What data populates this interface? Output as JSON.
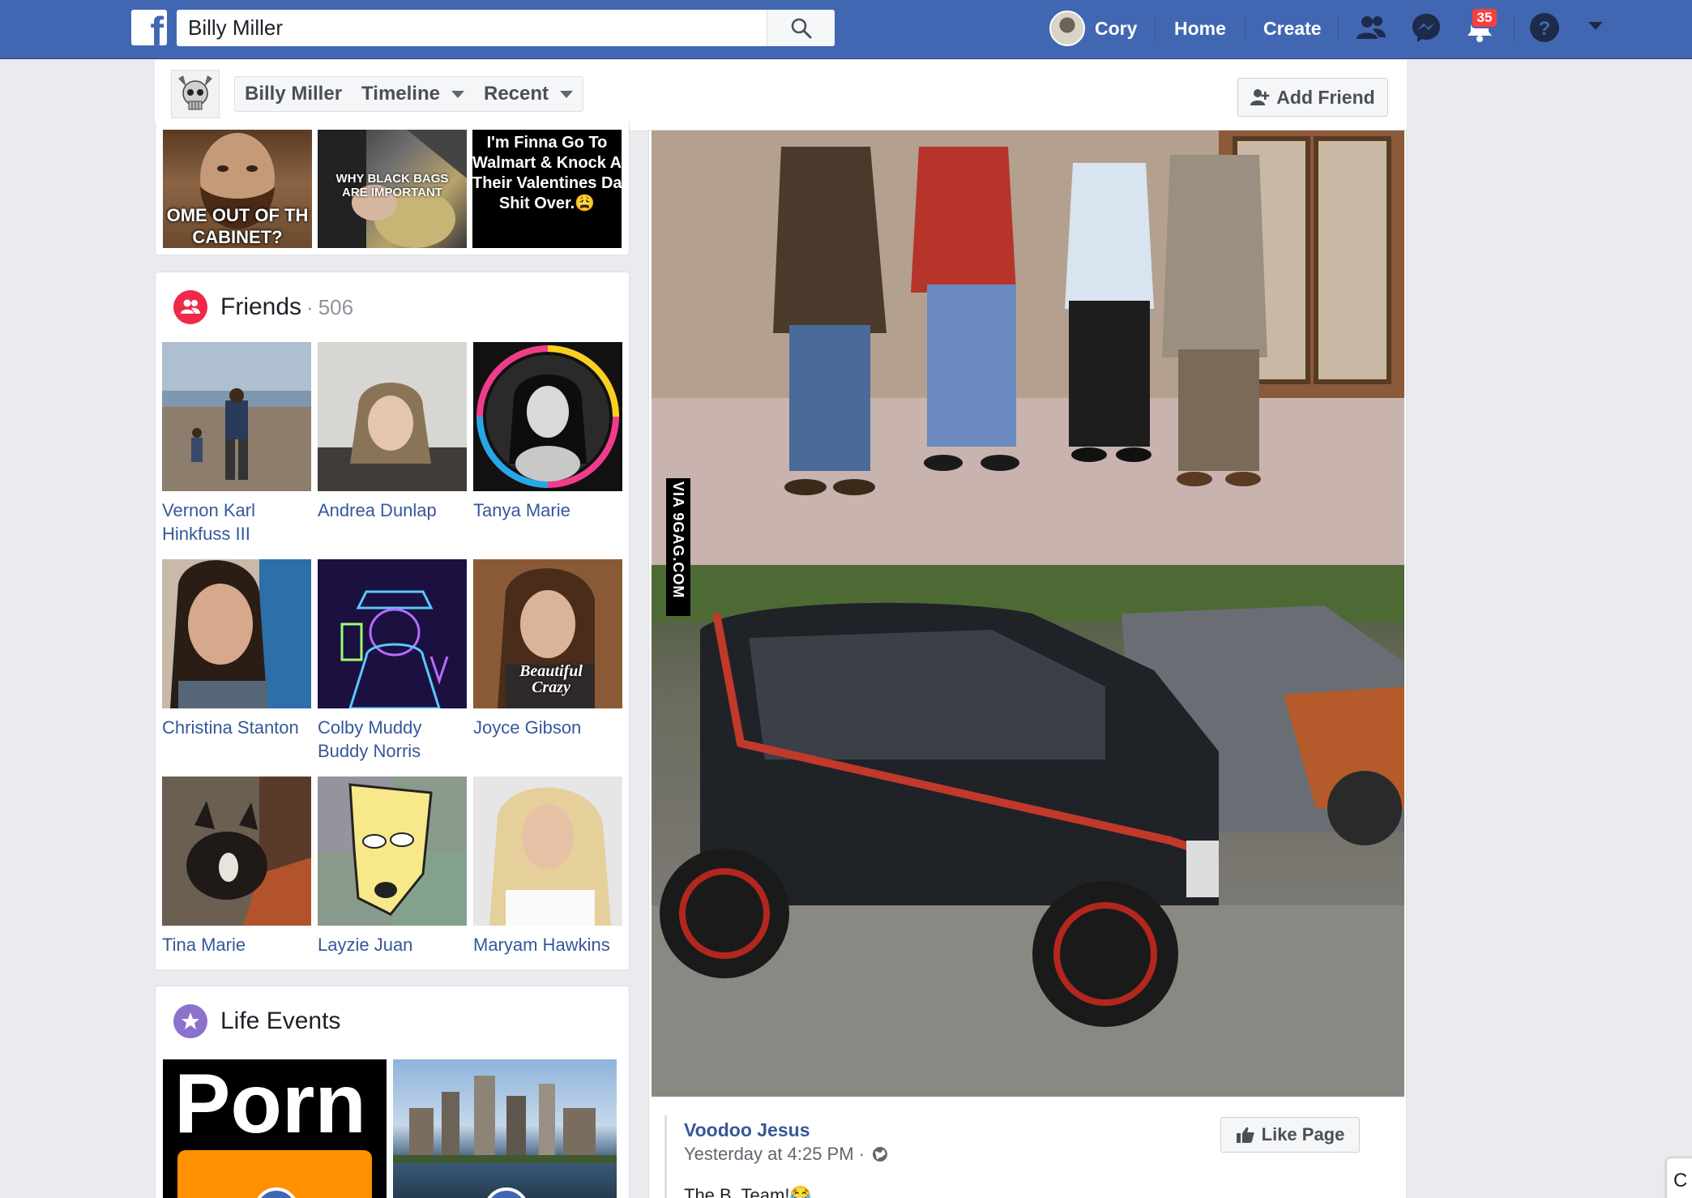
{
  "topbar": {
    "search_value": "Billy Miller",
    "user_name": "Cory",
    "nav": {
      "home": "Home",
      "create": "Create"
    },
    "notifications_count": "35",
    "brand_color": "#4267b2"
  },
  "subheader": {
    "tabs": [
      {
        "label": "Billy Miller"
      },
      {
        "label": "Timeline"
      },
      {
        "label": "Recent"
      }
    ],
    "add_friend": "Add Friend"
  },
  "photos": {
    "captions": [
      "OME OUT OF TH\nCABINET?",
      "WHY BLACK BAGS ARE IMPORTANT",
      "I'm Finna Go To\nWalmart & Knock All\nTheir Valentines Day\nShit Over.😩"
    ]
  },
  "friends": {
    "title": "Friends",
    "separator": "·",
    "count": "506",
    "list": [
      {
        "name": "Vernon Karl Hinkfuss III"
      },
      {
        "name": "Andrea Dunlap"
      },
      {
        "name": "Tanya Marie"
      },
      {
        "name": "Christina Stanton"
      },
      {
        "name": "Colby Muddy Buddy Norris"
      },
      {
        "name": "Joyce Gibson",
        "overlay": "Beautiful Crazy"
      },
      {
        "name": "Tina Marie"
      },
      {
        "name": "Layzie Juan"
      },
      {
        "name": "Maryam Hawkins"
      }
    ]
  },
  "life_events": {
    "title": "Life Events",
    "items": [
      {
        "text": "Porn"
      },
      {
        "text": ""
      }
    ]
  },
  "post": {
    "watermark": "VIA 9GAG.COM",
    "page_name": "Voodoo Jesus",
    "time": "Yesterday at 4:25 PM ·",
    "text": "The B. Team!😂",
    "like_page": "Like Page"
  },
  "chat_edge": "C"
}
